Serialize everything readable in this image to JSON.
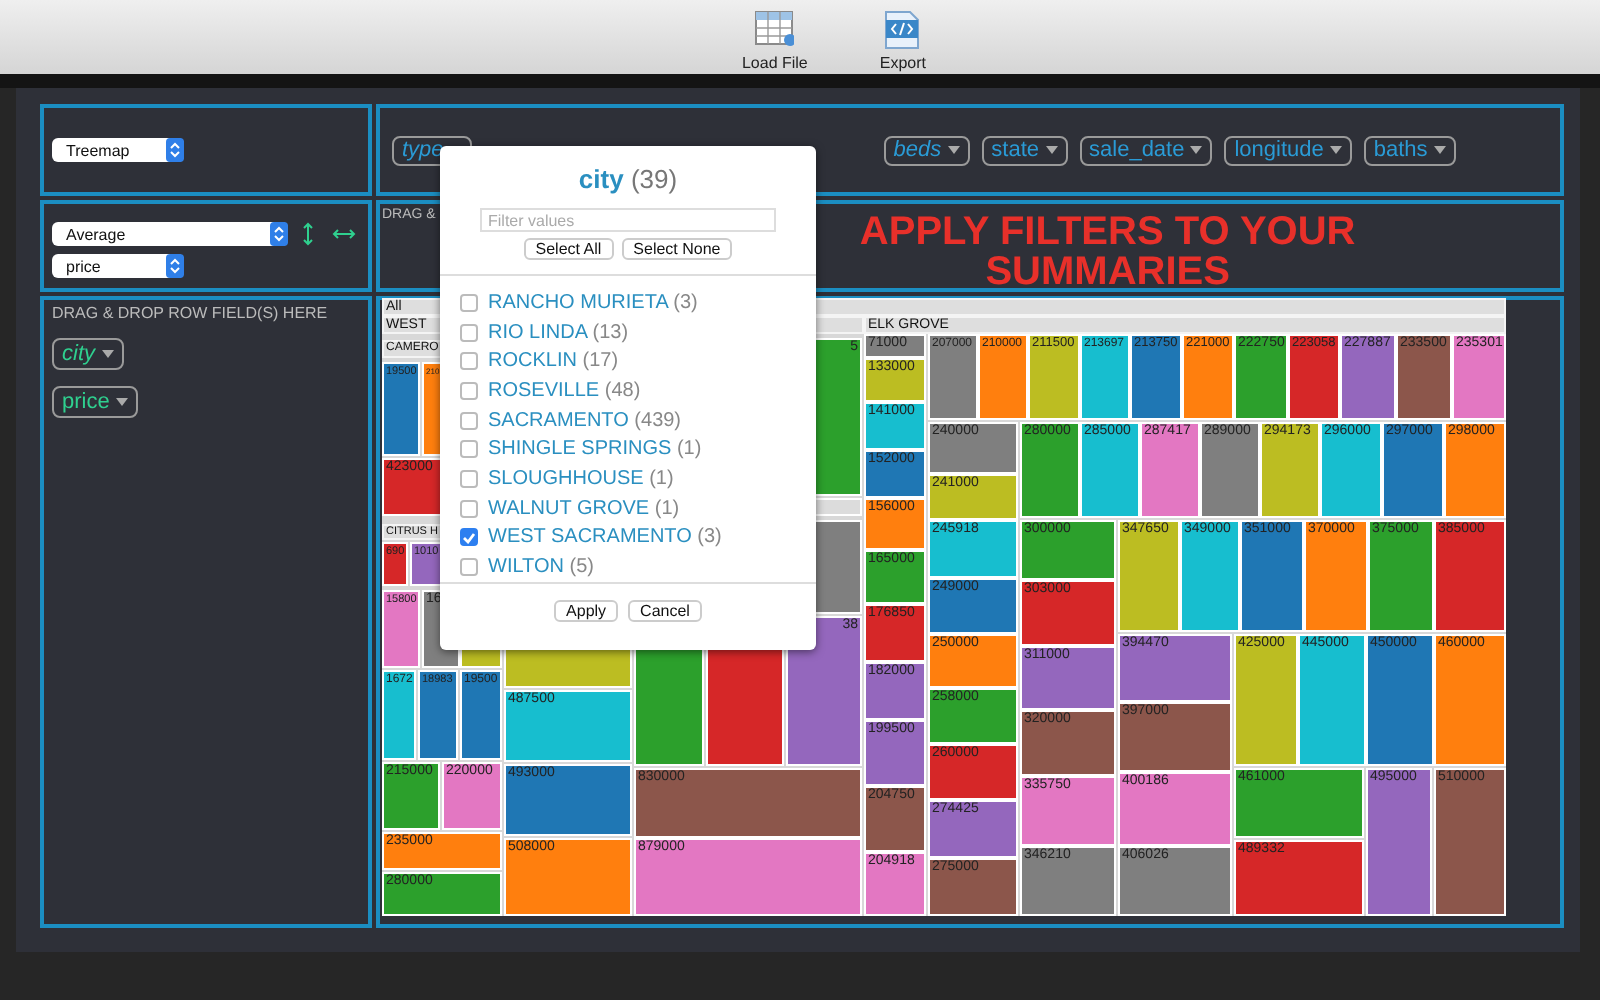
{
  "toolbar": {
    "buttons": [
      {
        "label": "Load File",
        "kind": "load"
      },
      {
        "label": "Export",
        "kind": "export"
      }
    ]
  },
  "renderer": {
    "value": "Treemap"
  },
  "aggregator": {
    "value": "Average",
    "attribute": "price"
  },
  "column_fields": [
    {
      "label": "type",
      "filtered": true
    },
    {
      "label": "beds",
      "filtered": true
    },
    {
      "label": "state",
      "filtered": false
    },
    {
      "label": "sale_date",
      "filtered": false
    },
    {
      "label": "longitude",
      "filtered": false
    },
    {
      "label": "baths",
      "filtered": false
    }
  ],
  "column_drop_hint": "DRAG &",
  "headline": "APPLY FILTERS TO YOUR SUMMARIES",
  "row_drop_hint": "DRAG & DROP ROW FIELD(S) HERE",
  "row_fields": [
    {
      "label": "city",
      "filtered": true
    },
    {
      "label": "price",
      "filtered": false
    }
  ],
  "treemap": {
    "headers": [
      {
        "label": "All"
      },
      {
        "label": "WEST"
      },
      {
        "label": "ELK GROVE"
      },
      {
        "label": "CAMERO"
      },
      {
        "label": "CITRUS H"
      }
    ],
    "cells": [
      {
        "label": "19500",
        "color": "#1f77b4"
      },
      {
        "label": "210",
        "color": "#ff7f0e"
      },
      {
        "label": "423000",
        "color": "#d62728"
      },
      {
        "label": "690",
        "color": "#d62728"
      },
      {
        "label": "1010",
        "color": "#9467bd"
      },
      {
        "label": "15800",
        "color": "#e377c2"
      },
      {
        "label": "16",
        "color": "#7f7f7f"
      },
      {
        "color": "#bcbd22"
      },
      {
        "label": "1672",
        "color": "#17becf"
      },
      {
        "label": "18983",
        "color": "#1f77b4"
      },
      {
        "label": "19500",
        "color": "#1f77b4"
      },
      {
        "label": "215000",
        "color": "#2ca02c"
      },
      {
        "label": "220000",
        "color": "#e377c2"
      },
      {
        "label": "235000",
        "color": "#ff7f0e"
      },
      {
        "label": "280000",
        "color": "#2ca02c"
      },
      {
        "color": "#bcbd22"
      },
      {
        "label": "487500",
        "color": "#17becf"
      },
      {
        "label": "493000",
        "color": "#1f77b4"
      },
      {
        "label": "508000",
        "color": "#ff7f0e"
      },
      {
        "color": "#2ca02c"
      },
      {
        "color": "#d62728"
      },
      {
        "label": "38",
        "color": "#9467bd"
      },
      {
        "label": "830000",
        "color": "#8c564b"
      },
      {
        "label": "879000",
        "color": "#e377c2"
      },
      {
        "color": "#7f7f7f"
      },
      {
        "label": "5",
        "color": "#2ca02c"
      },
      {
        "label": "71000",
        "color": "#7f7f7f"
      },
      {
        "label": "133000",
        "color": "#bcbd22"
      },
      {
        "label": "141000",
        "color": "#17becf"
      },
      {
        "label": "152000",
        "color": "#1f77b4"
      },
      {
        "label": "156000",
        "color": "#ff7f0e"
      },
      {
        "label": "165000",
        "color": "#2ca02c"
      },
      {
        "label": "176850",
        "color": "#d62728"
      },
      {
        "label": "182000",
        "color": "#9467bd"
      },
      {
        "label": "199500",
        "color": "#9467bd"
      },
      {
        "label": "204750",
        "color": "#8c564b"
      },
      {
        "label": "204918",
        "color": "#e377c2"
      },
      {
        "label": "207000",
        "color": "#7f7f7f"
      },
      {
        "label": "210000",
        "color": "#ff7f0e"
      },
      {
        "label": "211500",
        "color": "#bcbd22"
      },
      {
        "label": "213697",
        "color": "#17becf"
      },
      {
        "label": "213750",
        "color": "#1f77b4"
      },
      {
        "label": "221000",
        "color": "#ff7f0e"
      },
      {
        "label": "222750",
        "color": "#2ca02c"
      },
      {
        "label": "223058",
        "color": "#d62728"
      },
      {
        "label": "227887",
        "color": "#9467bd"
      },
      {
        "label": "233500",
        "color": "#8c564b"
      },
      {
        "label": "235301",
        "color": "#e377c2"
      },
      {
        "label": "240000",
        "color": "#7f7f7f"
      },
      {
        "label": "241000",
        "color": "#bcbd22"
      },
      {
        "label": "245918",
        "color": "#17becf"
      },
      {
        "label": "249000",
        "color": "#1f77b4"
      },
      {
        "label": "250000",
        "color": "#ff7f0e"
      },
      {
        "label": "258000",
        "color": "#2ca02c"
      },
      {
        "label": "260000",
        "color": "#d62728"
      },
      {
        "label": "274425",
        "color": "#9467bd"
      },
      {
        "label": "275000",
        "color": "#8c564b"
      },
      {
        "label": "280000",
        "color": "#2ca02c"
      },
      {
        "label": "285000",
        "color": "#17becf"
      },
      {
        "label": "287417",
        "color": "#e377c2"
      },
      {
        "label": "289000",
        "color": "#7f7f7f"
      },
      {
        "label": "294173",
        "color": "#bcbd22"
      },
      {
        "label": "296000",
        "color": "#17becf"
      },
      {
        "label": "297000",
        "color": "#1f77b4"
      },
      {
        "label": "298000",
        "color": "#ff7f0e"
      },
      {
        "label": "300000",
        "color": "#2ca02c"
      },
      {
        "label": "303000",
        "color": "#d62728"
      },
      {
        "label": "311000",
        "color": "#9467bd"
      },
      {
        "label": "320000",
        "color": "#8c564b"
      },
      {
        "label": "335750",
        "color": "#e377c2"
      },
      {
        "label": "346210",
        "color": "#7f7f7f"
      },
      {
        "label": "347650",
        "color": "#bcbd22"
      },
      {
        "label": "349000",
        "color": "#17becf"
      },
      {
        "label": "351000",
        "color": "#1f77b4"
      },
      {
        "label": "370000",
        "color": "#ff7f0e"
      },
      {
        "label": "375000",
        "color": "#2ca02c"
      },
      {
        "label": "385000",
        "color": "#d62728"
      },
      {
        "label": "394470",
        "color": "#9467bd"
      },
      {
        "label": "397000",
        "color": "#8c564b"
      },
      {
        "label": "400186",
        "color": "#e377c2"
      },
      {
        "label": "406026",
        "color": "#7f7f7f"
      },
      {
        "label": "425000",
        "color": "#bcbd22"
      },
      {
        "label": "445000",
        "color": "#17becf"
      },
      {
        "label": "450000",
        "color": "#1f77b4"
      },
      {
        "label": "460000",
        "color": "#ff7f0e"
      },
      {
        "label": "461000",
        "color": "#2ca02c"
      },
      {
        "label": "489332",
        "color": "#d62728"
      },
      {
        "label": "495000",
        "color": "#9467bd"
      },
      {
        "label": "510000",
        "color": "#8c564b"
      },
      {
        "color": "#dcdcdc"
      }
    ]
  },
  "filter_popup": {
    "field": "city",
    "count": "(39)",
    "placeholder": "Filter values",
    "actions": [
      "Select All",
      "Select None"
    ],
    "items": [
      {
        "label": "RANCHO MURIETA",
        "count": "(3)",
        "checked": false
      },
      {
        "label": "RIO LINDA",
        "count": "(13)",
        "checked": false
      },
      {
        "label": "ROCKLIN",
        "count": "(17)",
        "checked": false
      },
      {
        "label": "ROSEVILLE",
        "count": "(48)",
        "checked": false
      },
      {
        "label": "SACRAMENTO",
        "count": "(439)",
        "checked": false
      },
      {
        "label": "SHINGLE SPRINGS",
        "count": "(1)",
        "checked": false
      },
      {
        "label": "SLOUGHHOUSE",
        "count": "(1)",
        "checked": false
      },
      {
        "label": "WALNUT GROVE",
        "count": "(1)",
        "checked": false
      },
      {
        "label": "WEST SACRAMENTO",
        "count": "(3)",
        "checked": true
      },
      {
        "label": "WILTON",
        "count": "(5)",
        "checked": false
      }
    ],
    "buttons": [
      "Apply",
      "Cancel"
    ]
  }
}
